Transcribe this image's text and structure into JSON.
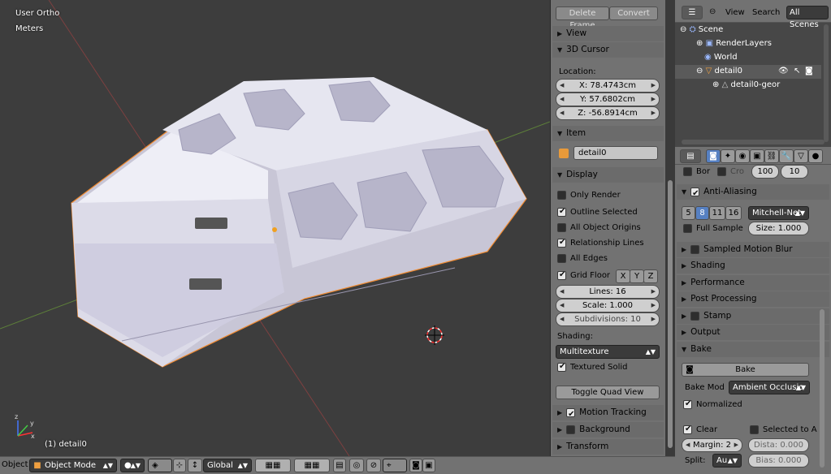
{
  "viewport": {
    "view_label": "User Ortho",
    "units_label": "Meters",
    "object_label": "(1) detail0"
  },
  "npanel": {
    "top_buttons": [
      "Delete Frame",
      "Convert"
    ],
    "view_label": "View",
    "cursor": {
      "title": "3D Cursor",
      "location_label": "Location:",
      "x": "X: 78.4743cm",
      "y": "Y: 57.6802cm",
      "z": "Z: -56.8914cm"
    },
    "item": {
      "title": "Item",
      "name": "detail0"
    },
    "display": {
      "title": "Display",
      "options": [
        {
          "label": "Only Render",
          "checked": false
        },
        {
          "label": "Outline Selected",
          "checked": true
        },
        {
          "label": "All Object Origins",
          "checked": false
        },
        {
          "label": "Relationship Lines",
          "checked": true
        },
        {
          "label": "All Edges",
          "checked": false
        }
      ],
      "grid_floor": {
        "label": "Grid Floor",
        "checked": true,
        "axes": [
          "X",
          "Y",
          "Z"
        ]
      },
      "lines": "Lines: 16",
      "scale": "Scale: 1.000",
      "subdivisions": "Subdivisions: 10",
      "shading_label": "Shading:",
      "shading_value": "Multitexture",
      "textured_solid": "Textured Solid",
      "toggle_quad": "Toggle Quad View"
    },
    "collapsed": [
      "Motion Tracking",
      "Background Images",
      "Transform Orientations"
    ]
  },
  "outliner": {
    "menu": [
      "View",
      "Search"
    ],
    "all_scenes": "All Scenes",
    "items": [
      "Scene",
      "RenderLayers",
      "World",
      "detail0",
      "detail0-geor"
    ]
  },
  "properties": {
    "border": "Bor",
    "crop": "Cro",
    "res_pct": "100",
    "res_val": "10",
    "anti_aliasing": "Anti-Aliasing",
    "aa_samples": [
      "5",
      "8",
      "11",
      "16"
    ],
    "aa_selected": "8",
    "filter": "Mitchell-Net",
    "full_sample": "Full Sample",
    "size": "Size: 1.000",
    "panels": [
      "Sampled Motion Blur",
      "Shading",
      "Performance",
      "Post Processing",
      "Stamp",
      "Output"
    ],
    "bake": {
      "title": "Bake",
      "button": "Bake",
      "mode_label": "Bake Mod",
      "mode_value": "Ambient Occlusio",
      "normalized": "Normalized",
      "clear": "Clear",
      "selected_to_active": "Selected to A",
      "margin": "Margin: 2",
      "distance": "Dista: 0.000",
      "split_label": "Split:",
      "split_value": "Au",
      "bias": "Bias: 0.000"
    }
  },
  "footer": {
    "object_label": "Object",
    "mode": "Object Mode",
    "orientation": "Global"
  },
  "colors": {
    "accent_blue": "#5680c2",
    "panel_bg": "#727272",
    "viewport_bg": "#3d3d3d"
  }
}
